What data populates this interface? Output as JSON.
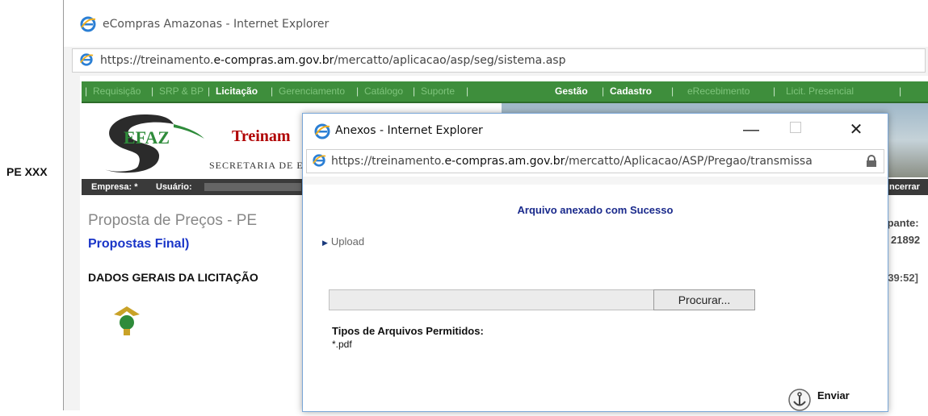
{
  "outer": {
    "window_title": "eCompras Amazonas - Internet Explorer",
    "url_prefix": "https://treinamento.",
    "url_domain": "e-compras.am.gov.br",
    "url_path": "/mercatto/aplicacao/asp/seg/sistema.asp"
  },
  "side_label": "PE XXX",
  "top_partial": "p",
  "nav": {
    "items": [
      {
        "label": "Requisição"
      },
      {
        "label": "SRP & BP"
      },
      {
        "label": "Licitação"
      },
      {
        "label": "Gerenciamento"
      },
      {
        "label": "Catálogo"
      },
      {
        "label": "Suporte"
      },
      {
        "label": "Gestão"
      },
      {
        "label": "Cadastro"
      },
      {
        "label": "eRecebimento"
      },
      {
        "label": "Licit. Presencial"
      }
    ],
    "separator": "|"
  },
  "banner": {
    "logo_text": "EFAZ",
    "title_partial": "Treinam",
    "subtitle_partial": "SECRETARIA DE ES"
  },
  "user_bar": {
    "empresa_label": "Empresa: *",
    "usuario_label": "Usuário:",
    "encerrar": "ncerrar"
  },
  "page": {
    "proposta_title": "Proposta de Preços - PE",
    "propostas_final": "Propostas Final)",
    "participante_partial": "ipante:",
    "number_partial": "21892",
    "dados_gerais": "DADOS GERAIS DA LICITAÇÃO",
    "time_partial": ":39:52]"
  },
  "modal": {
    "title": "Anexos - Internet Explorer",
    "url_prefix": "https://treinamento.",
    "url_domain": "e-compras.am.gov.br",
    "url_path": "/mercatto/Aplicacao/ASP/Pregao/transmissa",
    "success_message": "Arquivo anexado com Sucesso",
    "upload_label": "Upload",
    "browse_label": "Procurar...",
    "allowed_title": "Tipos de Arquivos Permitidos:",
    "allowed_value": "*.pdf",
    "send_label": "Enviar",
    "minimize_glyph": "—",
    "close_glyph": "✕"
  },
  "colors": {
    "nav_green": "#3e8e3c",
    "link_blue": "#1a35c8",
    "success_blue": "#1a2a8c",
    "sefaz_red": "#b00000"
  }
}
